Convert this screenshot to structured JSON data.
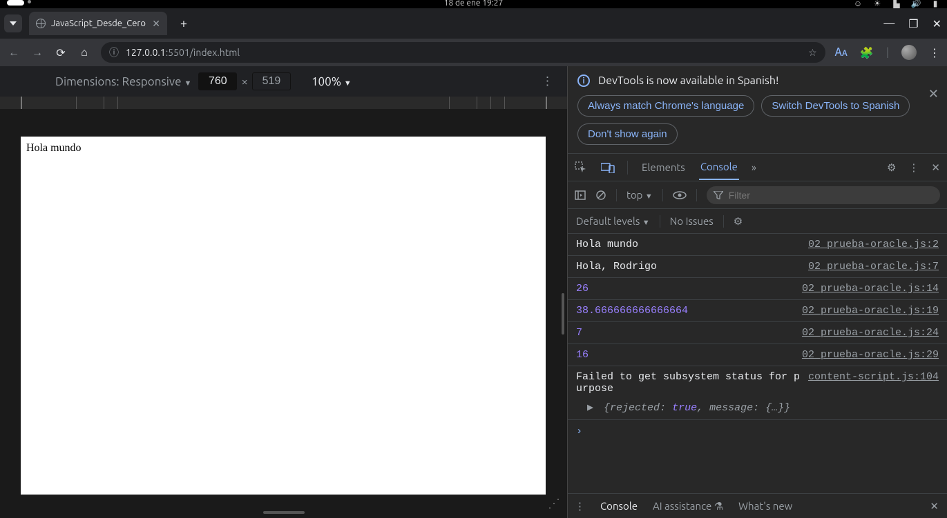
{
  "menubar": {
    "clock": "18 de ene  19:27"
  },
  "tabstrip": {
    "tab_title": "JavaScript_Desde_Cero"
  },
  "addressbar": {
    "url_prefix": "127.0.0.1",
    "url_suffix": ":5501/index.html"
  },
  "devicebar": {
    "label": "Dimensions: Responsive",
    "width": "760",
    "height": "519",
    "zoom": "100%"
  },
  "page": {
    "content": "Hola mundo"
  },
  "infobar": {
    "title": "DevTools is now available in Spanish!",
    "btn1": "Always match Chrome's language",
    "btn2": "Switch DevTools to Spanish",
    "btn3": "Don't show again"
  },
  "dt_tabs": {
    "elements": "Elements",
    "console": "Console"
  },
  "console_toolbar": {
    "context": "top",
    "filter_placeholder": "Filter"
  },
  "console_toolbar2": {
    "levels": "Default levels",
    "issues": "No Issues"
  },
  "logs": [
    {
      "msg": "Hola mundo",
      "type": "str",
      "src": "02_prueba-oracle.js:2"
    },
    {
      "msg": "Hola, Rodrigo",
      "type": "str",
      "src": "02_prueba-oracle.js:7"
    },
    {
      "msg": "26",
      "type": "num",
      "src": "02_prueba-oracle.js:14"
    },
    {
      "msg": "38.666666666666664",
      "type": "num",
      "src": "02_prueba-oracle.js:19"
    },
    {
      "msg": "7",
      "type": "num",
      "src": "02_prueba-oracle.js:24"
    },
    {
      "msg": "16",
      "type": "num",
      "src": "02_prueba-oracle.js:29"
    },
    {
      "msg": "Failed to get subsystem status for purpose",
      "type": "str",
      "src": "content-script.js:104"
    }
  ],
  "obj_preview": {
    "rejected_key": "rejected",
    "rejected_val": "true",
    "message_key": "message"
  },
  "drawer": {
    "console": "Console",
    "ai": "AI assistance",
    "whatsnew": "What's new"
  }
}
